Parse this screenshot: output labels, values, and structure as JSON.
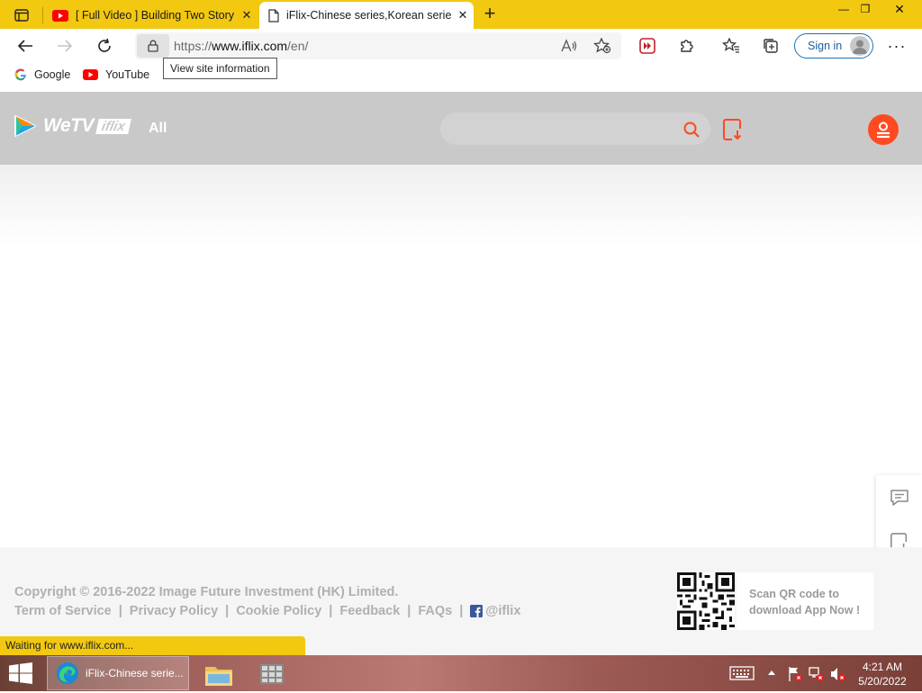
{
  "browser": {
    "tabs": [
      {
        "title": "[ Full Video ] Building Two Story",
        "icon": "youtube-icon",
        "active": false
      },
      {
        "title": "iFlix-Chinese series,Korean series",
        "icon": "page-icon",
        "active": true
      }
    ],
    "url_prefix": "https://",
    "url_host": "www.iflix.com",
    "url_path": "/en/",
    "sign_in_label": "Sign in",
    "tooltip": "View site information",
    "bookmarks": [
      {
        "label": "Google",
        "icon": "google-icon"
      },
      {
        "label": "YouTube",
        "icon": "youtube-icon"
      }
    ],
    "status_text": "Waiting for www.iflix.com...",
    "accent_color": "#f2c811"
  },
  "site": {
    "logo_text": "WeTV",
    "logo_sub": "iflix",
    "nav_all": "All",
    "search_placeholder": "",
    "accent_color": "#ff4a22",
    "footer": {
      "copyright": "Copyright © 2016-2022 Image Future Investment (HK) Limited.",
      "links": [
        "Term of Service",
        "Privacy Policy",
        "Cookie Policy",
        "Feedback",
        "FAQs"
      ],
      "facebook_handle": "@iflix",
      "qr_text_1": "Scan QR code to",
      "qr_text_2": "download App Now !"
    }
  },
  "taskbar": {
    "active_app_label": "iFlix-Chinese serie...",
    "time": "4:21 AM",
    "date": "5/20/2022"
  }
}
